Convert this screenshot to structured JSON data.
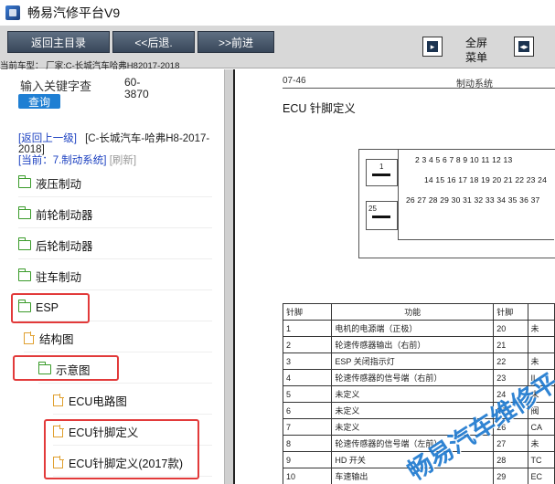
{
  "app": {
    "title": "畅易汽修平台V9"
  },
  "toolbar": {
    "main_menu": "返回主目录",
    "back": "<<后退.",
    "forward": ">>前进",
    "fullscreen_line1": "全屏",
    "fullscreen_line2": "菜单"
  },
  "model_bar": "当前车型： 厂家:C-长城汽车哈弗H82017-2018",
  "search": {
    "label": "输入关键字查",
    "button": "查询",
    "code_line1": "60-",
    "code_line2": "3870"
  },
  "nav": {
    "back_up": "[返回上一级]",
    "breadcrumb": "[C-长城汽车-哈弗H8-2017-2018]",
    "current": "[当前：7.制动系统]",
    "refresh": "[刷新]"
  },
  "tree": [
    {
      "label": "液压制动",
      "type": "folder"
    },
    {
      "label": "前轮制动器",
      "type": "folder"
    },
    {
      "label": "后轮制动器",
      "type": "folder"
    },
    {
      "label": "驻车制动",
      "type": "folder"
    },
    {
      "label": "ESP",
      "type": "folder-open"
    },
    {
      "label": "结构图",
      "type": "file"
    },
    {
      "label": "示意图",
      "type": "folder-open"
    },
    {
      "label": "ECU电路图",
      "type": "file"
    },
    {
      "label": "ECU针脚定义",
      "type": "file"
    },
    {
      "label": "ECU针脚定义(2017款)",
      "type": "file"
    }
  ],
  "document": {
    "page_no": "07-46",
    "section": "制动系统",
    "title": "ECU 针脚定义",
    "connector": {
      "pin1": "1",
      "pin25": "25",
      "row1": "2   3   4   5   6   7   8   9  10  11  12  13",
      "row2": "14  15  16  17  18  19  20  21  22  23  24",
      "row3": "26  27  28  29  30  31  32  33  34  35  36  37"
    },
    "table": {
      "headers": [
        "针脚",
        "功能",
        "针脚",
        ""
      ],
      "rows": [
        [
          "1",
          "电机的电源端（正极）",
          "20",
          "未"
        ],
        [
          "2",
          "轮速传感器输出（右前）",
          "21",
          ""
        ],
        [
          "3",
          "ESP 关闭指示灯",
          "22",
          "未"
        ],
        [
          "4",
          "轮速传感器的信号端（右前）",
          "23",
          "IL"
        ],
        [
          "5",
          "未定义",
          "24",
          "未"
        ],
        [
          "6",
          "未定义",
          "25",
          "阀"
        ],
        [
          "7",
          "未定义",
          "26",
          "CA"
        ],
        [
          "8",
          "轮速传感器的信号端（左前）",
          "27",
          "未"
        ],
        [
          "9",
          "HD 开关",
          "28",
          "TC"
        ],
        [
          "10",
          "车速输出",
          "29",
          "EC"
        ]
      ]
    },
    "watermark": "畅易汽车维修平"
  },
  "colors": {
    "toolbar_btn": "#4a596c",
    "highlight": "#e23a3a",
    "link": "#1a3fc0",
    "search_btn": "#1f7fd3"
  }
}
